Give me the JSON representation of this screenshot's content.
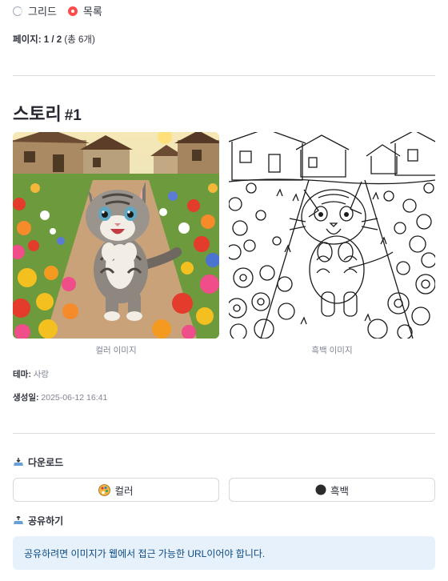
{
  "view_mode": {
    "options": [
      {
        "label": "그리드",
        "selected": false
      },
      {
        "label": "목록",
        "selected": true
      }
    ]
  },
  "pagination": {
    "label": "페이지:",
    "value": "1 / 2",
    "total": "(총 6개)"
  },
  "story": {
    "title_prefix": "스토리",
    "title_number": "#1",
    "color_caption": "컬러 이미지",
    "bw_caption": "흑백 이미지",
    "theme_label": "테마:",
    "theme_value": "사랑",
    "created_label": "생성일:",
    "created_value": "2025-06-12 16:41"
  },
  "download": {
    "heading": "다운로드",
    "color_button": "컬러",
    "bw_button": "흑백",
    "color_icon": "palette-icon",
    "bw_icon": "black-circle-icon"
  },
  "share": {
    "heading": "공유하기",
    "info_text": "공유하려면 이미지가 웹에서 접근 가능한 URL이어야 합니다."
  },
  "colors": {
    "accent": "#ff4b4b",
    "info_bg": "#e6f1fb",
    "info_text": "#0b4a82"
  }
}
